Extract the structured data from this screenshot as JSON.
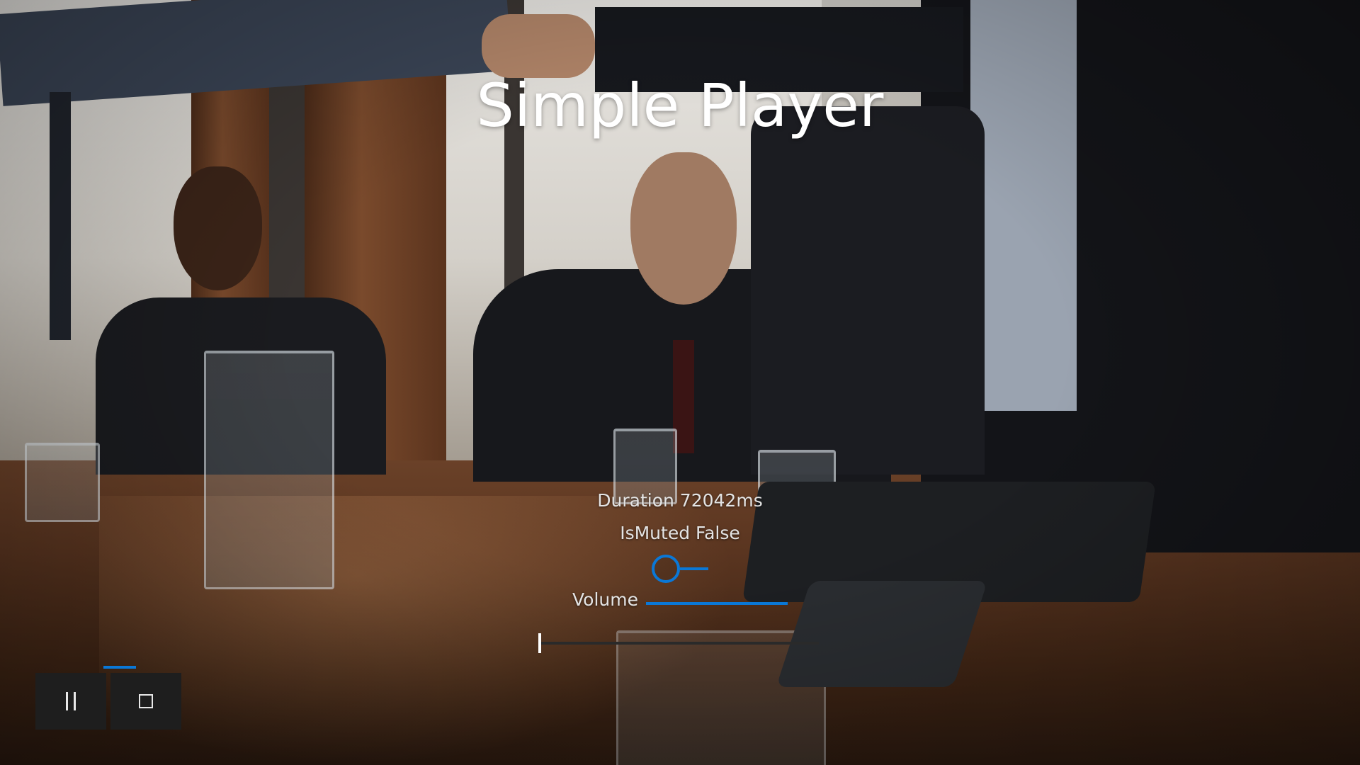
{
  "app": {
    "title": "Simple Player"
  },
  "media": {
    "duration_text": "Duration 72042ms",
    "muted_text": "IsMuted False",
    "is_muted": false,
    "volume_label": "Volume",
    "volume_level": 1.0,
    "position_fraction": 0.0
  },
  "controls": {
    "pause_icon": "pause-icon",
    "stop_icon": "stop-icon"
  },
  "colors": {
    "accent": "#0a78d7",
    "button_bg": "#1e1e1e",
    "text": "#e4e4e4"
  }
}
